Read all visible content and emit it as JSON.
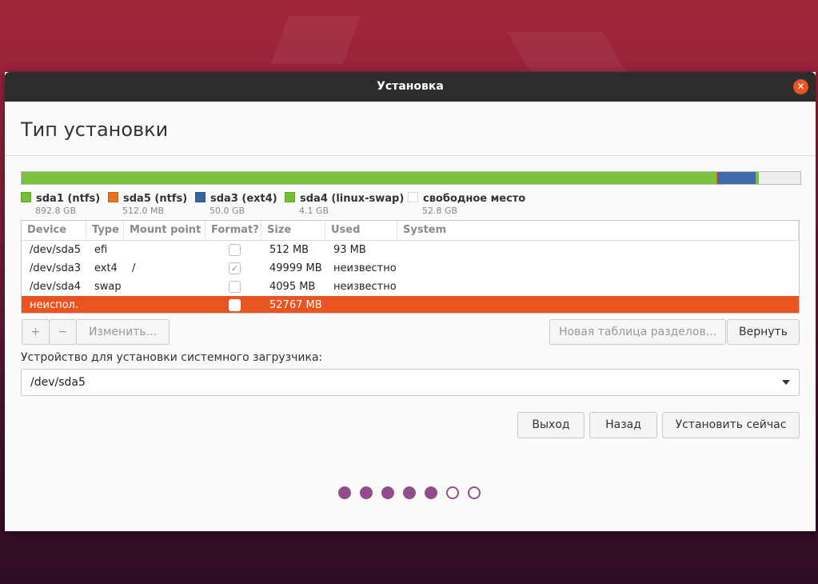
{
  "window": {
    "title": "Установка",
    "close_icon": "close-icon",
    "page_title": "Тип установки"
  },
  "partition_bar": [
    {
      "name": "sda1",
      "color": "#7cc13d",
      "fraction": 0.8925
    },
    {
      "name": "sda5",
      "color": "#e56f0f",
      "fraction": 0.0005
    },
    {
      "name": "sda3",
      "color": "#3f69a8",
      "fraction": 0.05
    },
    {
      "name": "sda4",
      "color": "#7cc13d",
      "fraction": 0.0041
    },
    {
      "name": "free",
      "color": "#eeeeee",
      "fraction": 0.0528
    }
  ],
  "legend": [
    {
      "name": "sda1 (ntfs)",
      "size": "892.8 GB",
      "color": "#73c034"
    },
    {
      "name": "sda5 (ntfs)",
      "size": "512.0 MB",
      "color": "#e9731c"
    },
    {
      "name": "sda3 (ext4)",
      "size": "50.0 GB",
      "color": "#3b639f"
    },
    {
      "name": "sda4 (linux-swap)",
      "size": "4.1 GB",
      "color": "#73c034"
    },
    {
      "name": "свободное место",
      "size": "52.8 GB",
      "color": "#ffffff"
    }
  ],
  "table": {
    "columns": [
      "Device",
      "Type",
      "Mount point",
      "Format?",
      "Size",
      "Used",
      "System"
    ],
    "rows": [
      {
        "device": "/dev/sda5",
        "type": "efi",
        "mount": "",
        "format": false,
        "format_enabled": false,
        "size": "512 MB",
        "used": "93 MB",
        "system": ""
      },
      {
        "device": "/dev/sda3",
        "type": "ext4",
        "mount": "/",
        "format": true,
        "format_enabled": false,
        "size": "49999 MB",
        "used": "неизвестно",
        "system": ""
      },
      {
        "device": "/dev/sda4",
        "type": "swap",
        "mount": "",
        "format": false,
        "format_enabled": false,
        "size": "4095 MB",
        "used": "неизвестно",
        "system": ""
      },
      {
        "device": "неиспол.",
        "type": "",
        "mount": "",
        "format": false,
        "format_enabled": true,
        "size": "52767 MB",
        "used": "",
        "system": "",
        "selected": true
      }
    ],
    "checkmark": "✓"
  },
  "toolbar": {
    "add_label": "+",
    "remove_label": "−",
    "change_label": "Изменить...",
    "new_table_label": "Новая таблица разделов...",
    "revert_label": "Вернуть"
  },
  "bootloader": {
    "label": "Устройство для установки системного загрузчика:",
    "value": "/dev/sda5"
  },
  "nav": {
    "quit_label": "Выход",
    "back_label": "Назад",
    "install_label": "Установить сейчас"
  },
  "progress": {
    "total_steps": 7,
    "completed_steps": 5
  },
  "accent_color": "#e95420"
}
